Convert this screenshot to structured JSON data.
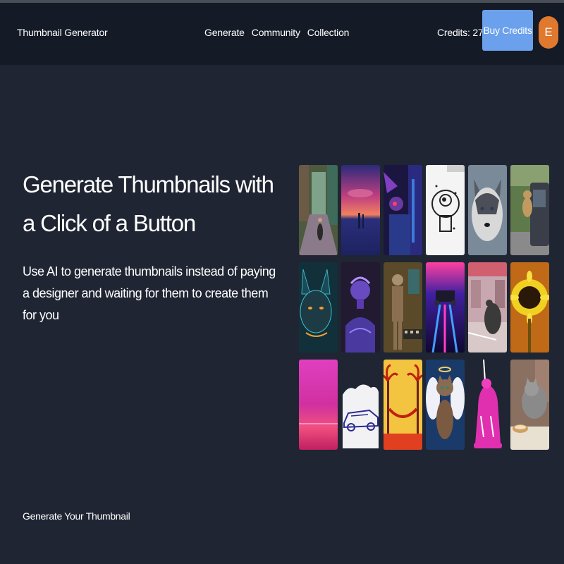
{
  "header": {
    "brand": "Thumbnail Generator",
    "nav": [
      "Generate",
      "Community",
      "Collection"
    ],
    "credits_text": "Credits: 279",
    "buy_label": "Buy Credits",
    "avatar_initial": "E"
  },
  "hero": {
    "title": "Generate Thumbnails with a Click of a Button",
    "subtitle": "Use AI to generate thumbnails instead of paying a designer and waiting for them to create them for you"
  },
  "thumbnails": [
    {
      "name": "thumbnail-cyclist-street"
    },
    {
      "name": "thumbnail-sunset-lake"
    },
    {
      "name": "thumbnail-neon-robot"
    },
    {
      "name": "thumbnail-astronaut-sketch"
    },
    {
      "name": "thumbnail-husky-dog"
    },
    {
      "name": "thumbnail-bear-car"
    },
    {
      "name": "thumbnail-neon-cat"
    },
    {
      "name": "thumbnail-statue-bust"
    },
    {
      "name": "thumbnail-robot-chess"
    },
    {
      "name": "thumbnail-neon-race-car"
    },
    {
      "name": "thumbnail-dog-city"
    },
    {
      "name": "thumbnail-sunflower"
    },
    {
      "name": "thumbnail-pink-sea"
    },
    {
      "name": "thumbnail-car-sketch"
    },
    {
      "name": "thumbnail-palm-hammock"
    },
    {
      "name": "thumbnail-angel-cat"
    },
    {
      "name": "thumbnail-unicorn-figure"
    },
    {
      "name": "thumbnail-cat-coffee"
    }
  ],
  "footer": {
    "label": "Generate Your Thumbnail"
  },
  "colors": {
    "background": "#1f2532",
    "navbar": "#141a26",
    "accent": "#6aa0ec",
    "avatar": "#e0782e"
  }
}
